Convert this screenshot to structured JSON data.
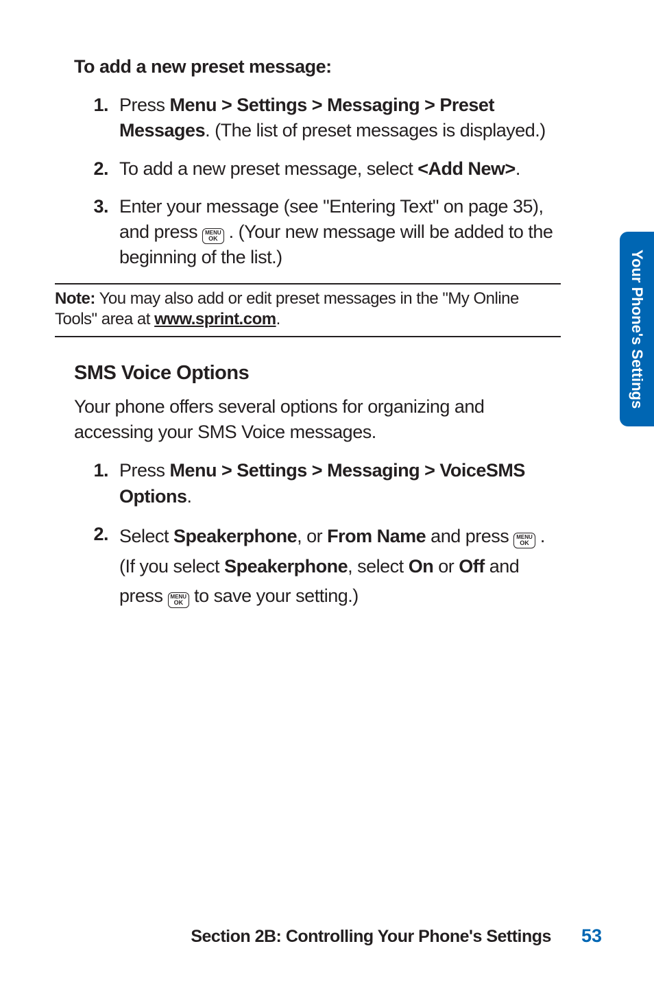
{
  "headings": {
    "addPreset": "To add a new preset message:",
    "smsVoice": "SMS Voice Options"
  },
  "steps_preset": {
    "s1_a": "Press ",
    "s1_b": "Menu > Settings > Messaging > Preset Messages",
    "s1_c": ". (The list of preset messages is displayed.)",
    "s2_a": "To add a new preset message, select ",
    "s2_b": "<Add New>",
    "s2_c": ".",
    "s3_a": "Enter your message (see \"Entering Text\" on page 35), and press ",
    "s3_b": " . (Your new message will be added to the beginning of the list.)"
  },
  "nums": {
    "n1": "1.",
    "n2": "2.",
    "n3": "3."
  },
  "note": {
    "label": "Note:",
    "text_a": " You may also add or edit preset messages in the \"My Online Tools\" area at ",
    "link": "www.sprint.com",
    "text_b": "."
  },
  "sms_intro": "Your phone offers several options for organizing and accessing your SMS Voice messages.",
  "steps_sms": {
    "s1_a": "Press ",
    "s1_b": "Menu > Settings > Messaging > VoiceSMS Options",
    "s1_c": ".",
    "s2_a": "Select ",
    "s2_b": "Speakerphone",
    "s2_c": ", or ",
    "s2_d": "From Name",
    "s2_e": " and press ",
    "s2_f": " . (If you select ",
    "s2_g": "Speakerphone",
    "s2_h": ", select ",
    "s2_i": "On",
    "s2_j": " or ",
    "s2_k": "Off",
    "s2_l": " and press ",
    "s2_m": " to save your setting.)"
  },
  "side_tab": "Your Phone's Settings",
  "footer": {
    "title": "Section 2B: Controlling Your Phone's Settings",
    "page": "53"
  },
  "menuok": {
    "l1": "MENU",
    "l2": "OK"
  }
}
